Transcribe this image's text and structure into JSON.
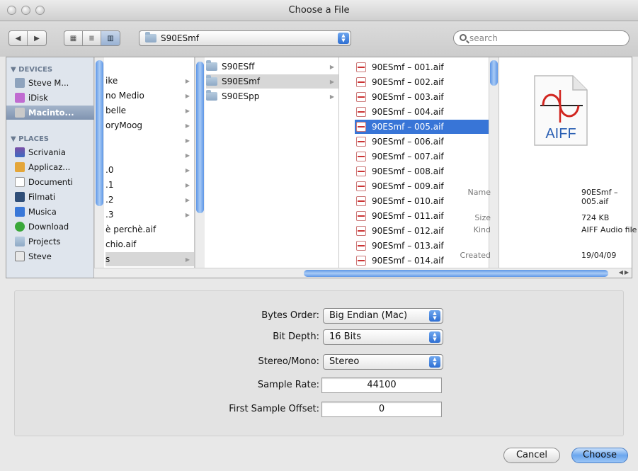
{
  "window": {
    "title": "Choose a File"
  },
  "toolbar": {
    "back_glyph": "◀",
    "forward_glyph": "▶",
    "view_icon_glyph": "▦",
    "view_list_glyph": "≣",
    "view_column_glyph": "▥",
    "path_value": "S90ESmf",
    "search_placeholder": "search"
  },
  "sidebar": {
    "devices_header": "▼ DEVICES",
    "places_header": "▼ PLACES",
    "devices": [
      {
        "label": "Steve M...",
        "icon": "computer-icon"
      },
      {
        "label": "iDisk",
        "icon": "idisk-icon"
      },
      {
        "label": "Macinto...",
        "icon": "hard-drive-icon",
        "selected": true
      }
    ],
    "places": [
      {
        "label": "Scrivania",
        "icon": "desktop-icon"
      },
      {
        "label": "Applicaz...",
        "icon": "applications-icon"
      },
      {
        "label": "Documenti",
        "icon": "documents-icon"
      },
      {
        "label": "Filmati",
        "icon": "movies-icon"
      },
      {
        "label": "Musica",
        "icon": "music-icon"
      },
      {
        "label": "Download",
        "icon": "download-icon"
      },
      {
        "label": "Projects",
        "icon": "folder-icon"
      },
      {
        "label": "Steve",
        "icon": "home-icon"
      }
    ]
  },
  "column1": {
    "items": [
      "ike",
      "no Medio",
      " belle",
      "oryMoog",
      "",
      "",
      ".0",
      ".1",
      ".2",
      ".3",
      "è perchè.aif",
      "chio.aif",
      "s"
    ]
  },
  "column2": {
    "items": [
      {
        "label": "S90ESff",
        "state": "normal"
      },
      {
        "label": "S90ESmf",
        "state": "selected"
      },
      {
        "label": "S90ESpp",
        "state": "normal"
      }
    ]
  },
  "column3": {
    "items": [
      "90ESmf – 001.aif",
      "90ESmf – 002.aif",
      "90ESmf – 003.aif",
      "90ESmf – 004.aif",
      "90ESmf – 005.aif",
      "90ESmf – 006.aif",
      "90ESmf – 007.aif",
      "90ESmf – 008.aif",
      "90ESmf – 009.aif",
      "90ESmf – 010.aif",
      "90ESmf – 011.aif",
      "90ESmf – 012.aif",
      "90ESmf – 013.aif",
      "90ESmf – 014.aif"
    ],
    "selected_index": 4
  },
  "preview": {
    "icon_text": "AIFF",
    "name_key": "Name",
    "name_value": "90ESmf – 005.aif",
    "size_key": "Size",
    "size_value": "724 KB",
    "kind_key": "Kind",
    "kind_value": "AIFF Audio file",
    "created_key": "Created",
    "created_value": "19/04/09"
  },
  "options": {
    "bytes_order": {
      "label": "Bytes Order:",
      "value": "Big Endian (Mac)"
    },
    "bit_depth": {
      "label": "Bit Depth:",
      "value": "16 Bits"
    },
    "stereo_mono": {
      "label": "Stereo/Mono:",
      "value": "Stereo"
    },
    "sample_rate": {
      "label": "Sample Rate:",
      "value": "44100"
    },
    "first_sample_offset": {
      "label": "First Sample Offset:",
      "value": "0"
    }
  },
  "buttons": {
    "cancel": "Cancel",
    "choose": "Choose"
  },
  "colors": {
    "selection_blue": "#3875d7",
    "sidebar_bg": "#dfe5ed",
    "scroll_blue": "#5d96e6"
  }
}
